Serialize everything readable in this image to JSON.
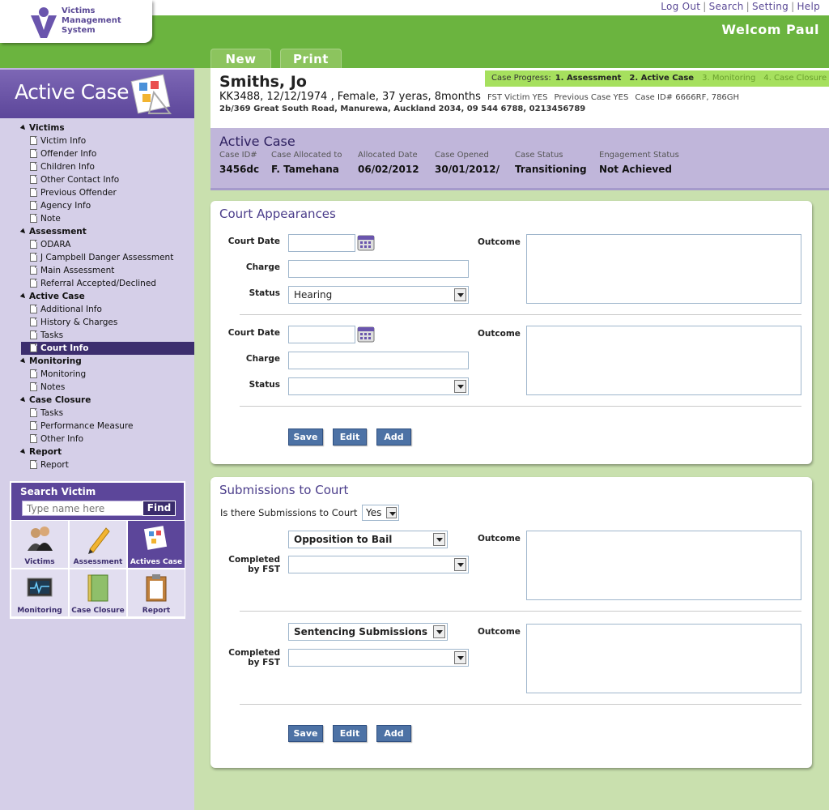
{
  "header": {
    "logo_lines": [
      "Victims",
      "Management",
      "System"
    ],
    "links": [
      "Log Out",
      "Search",
      "Setting",
      "Help"
    ],
    "welcome": "Welcom Paul",
    "tabs": [
      "New",
      "Print"
    ]
  },
  "sidebar": {
    "title": "Active Case",
    "groups": [
      {
        "label": "Victims",
        "items": [
          "Victim Info",
          "Offender Info",
          "Children Info",
          "Other Contact Info",
          "Previous Offender",
          "Agency Info",
          "Note"
        ]
      },
      {
        "label": "Assessment",
        "items": [
          "ODARA",
          "J Campbell Danger Assessment",
          "Main Assessment",
          "Referral Accepted/Declined"
        ]
      },
      {
        "label": "Active Case",
        "items": [
          "Additional Info",
          "History & Charges",
          "Tasks",
          "Court Info"
        ]
      },
      {
        "label": "Monitoring",
        "items": [
          "Monitoring",
          "Notes"
        ]
      },
      {
        "label": "Case Closure",
        "items": [
          "Tasks",
          "Performance Measure",
          "Other Info"
        ]
      },
      {
        "label": "Report",
        "items": [
          "Report"
        ]
      }
    ],
    "active_item": "Court Info",
    "search": {
      "label": "Search Victim",
      "placeholder": "Type name here",
      "button": "Find"
    },
    "tiles": [
      "Victims",
      "Assessment",
      "Actives Case",
      "Monitoring",
      "Case Closure",
      "Report"
    ]
  },
  "case": {
    "name": "Smiths, Jo",
    "details": "KK3488, 12/12/1974 , Female, 37 yeras, 8months",
    "fst": "FST Victim YES",
    "previous": "Previous Case YES",
    "case_ids": "Case ID# 6666RF, 786GH",
    "address": "2b/369 Great South Road, Manurewa, Auckland 2034, 09 544 6788, 0213456789",
    "progress_label": "Case Progress:",
    "progress_steps": [
      "1. Assessment",
      "2. Active Case",
      "3. Monitoring",
      "4. Case Closure"
    ]
  },
  "active_case": {
    "title": "Active Case",
    "fields": [
      {
        "k": "Case ID#",
        "v": "3456dc"
      },
      {
        "k": "Case Allocated to",
        "v": "F. Tamehana"
      },
      {
        "k": "Allocated Date",
        "v": "06/02/2012"
      },
      {
        "k": "Case Opened",
        "v": "30/01/2012/"
      },
      {
        "k": "Case Status",
        "v": "Transitioning"
      },
      {
        "k": "Engagement Status",
        "v": "Not Achieved"
      }
    ]
  },
  "court": {
    "title": "Court Appearances",
    "labels": {
      "date": "Court Date",
      "charge": "Charge",
      "status": "Status",
      "outcome": "Outcome"
    },
    "entries": [
      {
        "status": "Hearing"
      },
      {
        "status": ""
      }
    ],
    "buttons": [
      "Save",
      "Edit",
      "Add"
    ]
  },
  "submissions": {
    "title": "Submissions to Court",
    "question": "Is there Submissions to Court",
    "answer": "Yes",
    "completed_label": [
      "Completed",
      "by FST"
    ],
    "outcome": "Outcome",
    "entries": [
      {
        "type": "Opposition to Bail"
      },
      {
        "type": "Sentencing Submissions"
      }
    ],
    "buttons": [
      "Save",
      "Edit",
      "Add"
    ]
  }
}
